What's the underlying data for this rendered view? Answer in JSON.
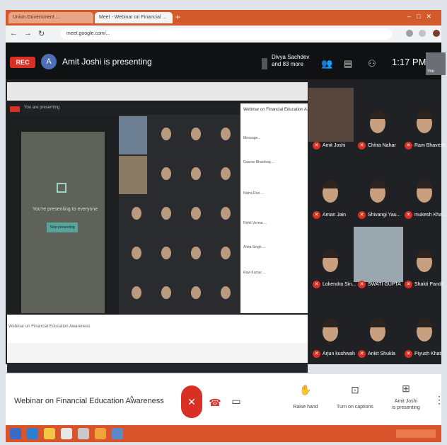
{
  "browser": {
    "tab1": "Union Government ...",
    "tab2": "Meet - Webinar on Financial ...",
    "url": "meet.google.com/..."
  },
  "meet": {
    "rec": "REC",
    "avatar_letter": "A",
    "presenting": "Amit Joshi is presenting",
    "others_line1": "Divya Sachdev",
    "others_line2": "and 83 more",
    "time": "1:17 PM",
    "you_label": "You",
    "title": "Webinar on Financial Education Awareness",
    "controls": {
      "raise_hand": "Raise hand",
      "captions": "Turn on captions",
      "presenting_line1": "Amit Joshi",
      "presenting_line2": "is presenting"
    }
  },
  "inner_share": {
    "banner": "You are presenting",
    "presenting_text": "You're presenting to everyone",
    "stop_button": "Stop presenting",
    "chat_title": "Webinar on Financial Education A...",
    "chat": [
      "Message...",
      "Gaurav Bhardwaj ...",
      "Nisha Rao ...",
      "Rohit Verma ...",
      "Anita Singh ...",
      "Ravi Kumar ..."
    ],
    "footer": "Webinar on Financial Education Awareness"
  },
  "participants": [
    {
      "name": "Amit Joshi"
    },
    {
      "name": "Chitra Nahar"
    },
    {
      "name": "Ram Bhavesh"
    },
    {
      "name": "Aman Jain"
    },
    {
      "name": "Shivangi Yau..."
    },
    {
      "name": "mukesh Kha..."
    },
    {
      "name": "Lokendra Sin..."
    },
    {
      "name": "SWATI GUPTA"
    },
    {
      "name": "Shakti Pandit"
    },
    {
      "name": "Arjun kushwah"
    },
    {
      "name": "Ankit Shukla"
    },
    {
      "name": "Piyush Khati"
    }
  ],
  "colors": {
    "rec": "#d93025",
    "taskbar": "#d9542b",
    "meet_dark": "#202124"
  }
}
